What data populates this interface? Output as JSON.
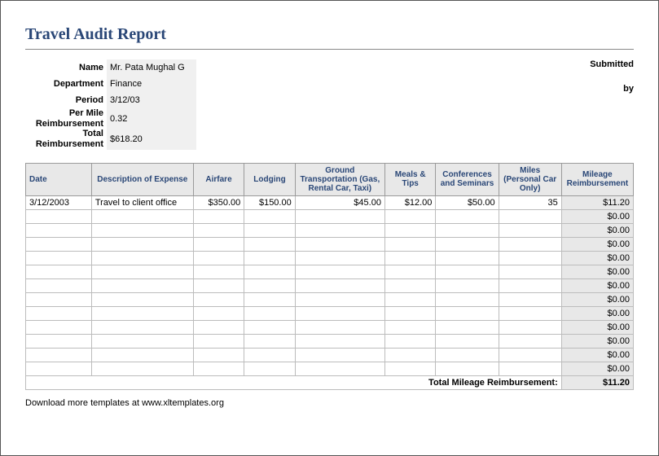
{
  "title": "Travel Audit Report",
  "submitted_label": "Submitted",
  "by_label": "by",
  "fields": {
    "name_label": "Name",
    "name_value": "Mr. Pata Mughal G",
    "dept_label": "Department",
    "dept_value": "Finance",
    "period_label": "Period",
    "period_value": "3/12/03",
    "permile_label_1": "Per Mile",
    "permile_label_2": "Reimbursement",
    "permile_value": "0.32",
    "total_label_1": "Total",
    "total_label_2": "Reimbursement",
    "total_value": "$618.20"
  },
  "columns": {
    "date": "Date",
    "desc": "Description of Expense",
    "air": "Airfare",
    "lodg": "Lodging",
    "ground": "Ground Transportation (Gas, Rental Car, Taxi)",
    "meals": "Meals & Tips",
    "conf": "Conferences and Seminars",
    "miles": "Miles (Personal Car Only)",
    "reimb": "Mileage Reimbursement"
  },
  "rows": [
    {
      "date": "3/12/2003",
      "desc": "Travel to client office",
      "air": "$350.00",
      "lodg": "$150.00",
      "ground": "$45.00",
      "meals": "$12.00",
      "conf": "$50.00",
      "miles": "35",
      "reimb": "$11.20"
    },
    {
      "date": "",
      "desc": "",
      "air": "",
      "lodg": "",
      "ground": "",
      "meals": "",
      "conf": "",
      "miles": "",
      "reimb": "$0.00"
    },
    {
      "date": "",
      "desc": "",
      "air": "",
      "lodg": "",
      "ground": "",
      "meals": "",
      "conf": "",
      "miles": "",
      "reimb": "$0.00"
    },
    {
      "date": "",
      "desc": "",
      "air": "",
      "lodg": "",
      "ground": "",
      "meals": "",
      "conf": "",
      "miles": "",
      "reimb": "$0.00"
    },
    {
      "date": "",
      "desc": "",
      "air": "",
      "lodg": "",
      "ground": "",
      "meals": "",
      "conf": "",
      "miles": "",
      "reimb": "$0.00"
    },
    {
      "date": "",
      "desc": "",
      "air": "",
      "lodg": "",
      "ground": "",
      "meals": "",
      "conf": "",
      "miles": "",
      "reimb": "$0.00"
    },
    {
      "date": "",
      "desc": "",
      "air": "",
      "lodg": "",
      "ground": "",
      "meals": "",
      "conf": "",
      "miles": "",
      "reimb": "$0.00"
    },
    {
      "date": "",
      "desc": "",
      "air": "",
      "lodg": "",
      "ground": "",
      "meals": "",
      "conf": "",
      "miles": "",
      "reimb": "$0.00"
    },
    {
      "date": "",
      "desc": "",
      "air": "",
      "lodg": "",
      "ground": "",
      "meals": "",
      "conf": "",
      "miles": "",
      "reimb": "$0.00"
    },
    {
      "date": "",
      "desc": "",
      "air": "",
      "lodg": "",
      "ground": "",
      "meals": "",
      "conf": "",
      "miles": "",
      "reimb": "$0.00"
    },
    {
      "date": "",
      "desc": "",
      "air": "",
      "lodg": "",
      "ground": "",
      "meals": "",
      "conf": "",
      "miles": "",
      "reimb": "$0.00"
    },
    {
      "date": "",
      "desc": "",
      "air": "",
      "lodg": "",
      "ground": "",
      "meals": "",
      "conf": "",
      "miles": "",
      "reimb": "$0.00"
    },
    {
      "date": "",
      "desc": "",
      "air": "",
      "lodg": "",
      "ground": "",
      "meals": "",
      "conf": "",
      "miles": "",
      "reimb": "$0.00"
    }
  ],
  "total_label": "Total Mileage Reimbursement:",
  "total_value": "$11.20",
  "footer": "Download more templates at www.xltemplates.org"
}
